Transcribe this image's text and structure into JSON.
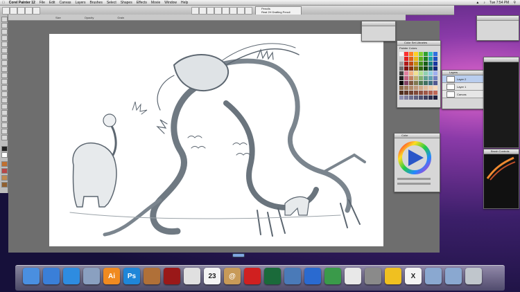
{
  "menubar": {
    "app": "Corel Painter 12",
    "items": [
      "File",
      "Edit",
      "Canvas",
      "Layers",
      "Brushes",
      "Select",
      "Shapes",
      "Effects",
      "Movie",
      "Window",
      "Help"
    ],
    "clock": "Tue 7:54 PM"
  },
  "toolbar": {
    "brush_category": "Pencils",
    "brush_variant": "Real 2H Drafting Pencil"
  },
  "propbar": {
    "fields": [
      "Size",
      "Opacity",
      "Grain"
    ]
  },
  "panels": {
    "color_set_title": "Color Set Libraries",
    "color_set_subtitle": "Painter Colors",
    "layers_title": "Layers",
    "layers": [
      "Layer 2",
      "Layer 1",
      "Canvas"
    ],
    "color_title": "Color",
    "brush_panel_title": "Brush Controls"
  },
  "dock": {
    "icons": [
      {
        "name": "finder-icon",
        "label": "",
        "color": "#4a8fe0"
      },
      {
        "name": "app-store-icon",
        "label": "",
        "color": "#3a7fd8"
      },
      {
        "name": "safari-icon",
        "label": "",
        "color": "#2e8ce0"
      },
      {
        "name": "preview-icon",
        "label": "",
        "color": "#8aa0c0"
      },
      {
        "name": "illustrator-icon",
        "label": "Ai",
        "color": "#f08a20"
      },
      {
        "name": "photoshop-icon",
        "label": "Ps",
        "color": "#1f86d8"
      },
      {
        "name": "painter-icon",
        "label": "",
        "color": "#b07038"
      },
      {
        "name": "photo-booth-icon",
        "label": "",
        "color": "#9a1818"
      },
      {
        "name": "chrome-icon",
        "label": "",
        "color": "#e0e0e0"
      },
      {
        "name": "calendar-icon",
        "label": "23",
        "color": "#f4f4f4"
      },
      {
        "name": "address-book-icon",
        "label": "@",
        "color": "#c89a58"
      },
      {
        "name": "acrobat-icon",
        "label": "",
        "color": "#d02020"
      },
      {
        "name": "time-machine-icon",
        "label": "",
        "color": "#1a6a3a"
      },
      {
        "name": "iphoto-icon",
        "label": "",
        "color": "#4a7ab8"
      },
      {
        "name": "google-earth-icon",
        "label": "",
        "color": "#2a6ad0"
      },
      {
        "name": "numbers-icon",
        "label": "",
        "color": "#3a9a4a"
      },
      {
        "name": "textedit-icon",
        "label": "",
        "color": "#e8e8e8"
      },
      {
        "name": "system-preferences-icon",
        "label": "",
        "color": "#8a8a8a"
      },
      {
        "name": "nat-geo-icon",
        "label": "",
        "color": "#f0c020"
      },
      {
        "name": "x11-icon",
        "label": "X",
        "color": "#f4f4f4"
      },
      {
        "name": "applications-folder-icon",
        "label": "",
        "color": "#8aa8d0"
      },
      {
        "name": "downloads-folder-icon",
        "label": "",
        "color": "#8aa8d0"
      },
      {
        "name": "trash-icon",
        "label": "",
        "color": "#c0c6cc"
      }
    ]
  }
}
